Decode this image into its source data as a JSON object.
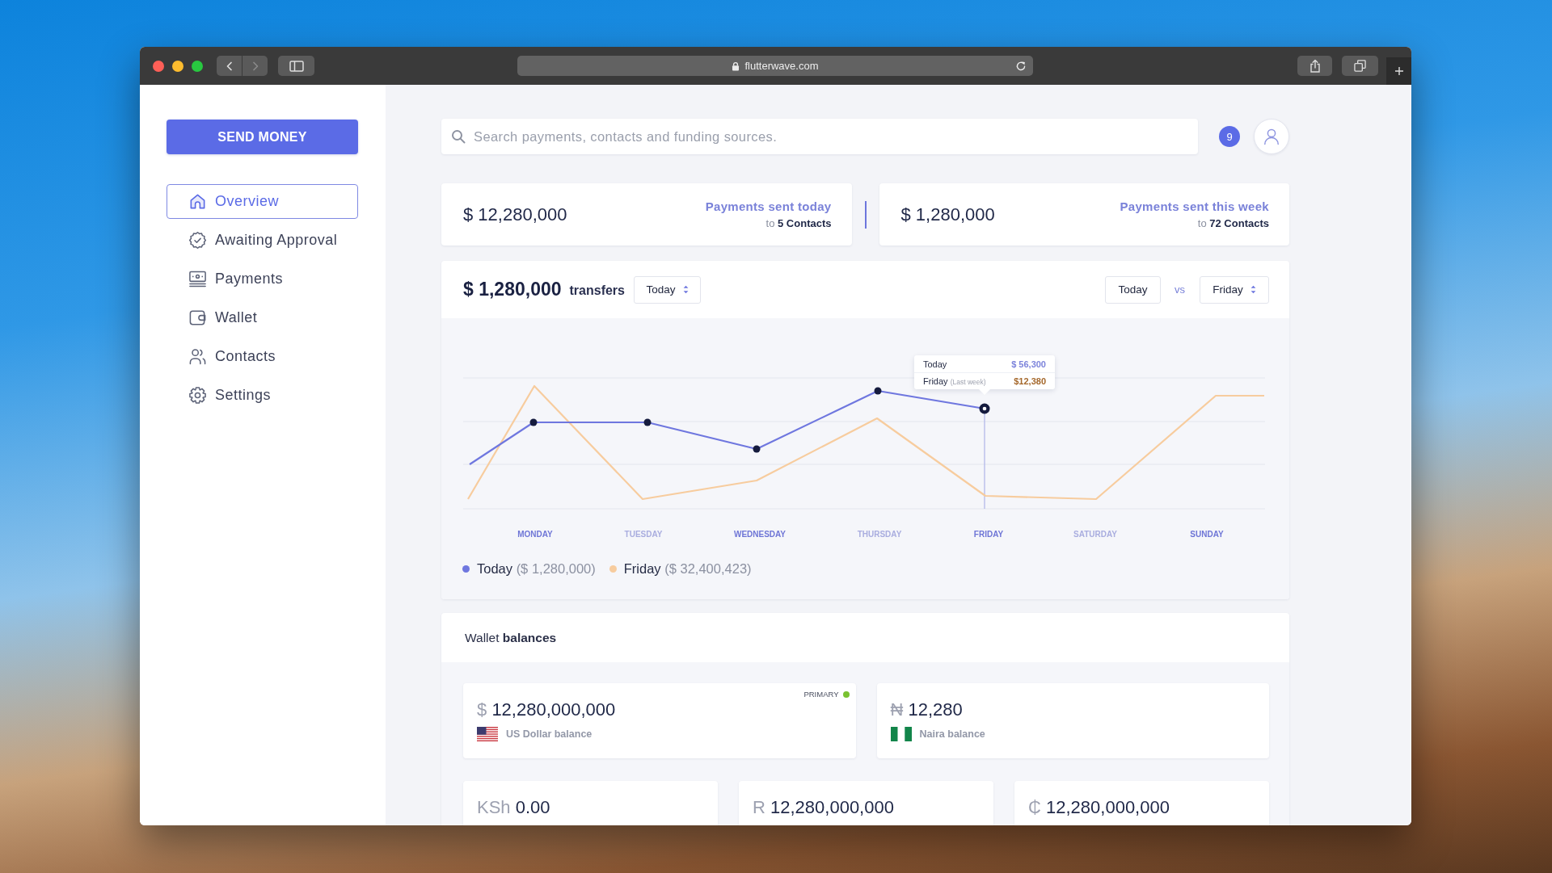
{
  "browser": {
    "url": "flutterwave.com",
    "forward_disabled": true
  },
  "sidebar": {
    "action_button": "SEND MONEY",
    "items": [
      {
        "label": "Overview",
        "selected": true
      },
      {
        "label": "Awaiting Approval",
        "selected": false
      },
      {
        "label": "Payments",
        "selected": false
      },
      {
        "label": "Wallet",
        "selected": false
      },
      {
        "label": "Contacts",
        "selected": false
      },
      {
        "label": "Settings",
        "selected": false
      }
    ]
  },
  "search": {
    "placeholder": "Search payments, contacts and funding sources."
  },
  "notifications": {
    "count": "9"
  },
  "stats": [
    {
      "amount": "$ 12,280,000",
      "title": "Payments sent today",
      "recipients": "to **5 Contacts**"
    },
    {
      "amount": "$ 1,280,000",
      "title": "Payments sent this week",
      "recipients": "to **72 Contacts**"
    }
  ],
  "transfers": {
    "amount": "$ 1,280,000",
    "label": "transfers",
    "period": "Today",
    "compare": {
      "current": "Today",
      "separator": "vs",
      "other": "Friday"
    },
    "chart": {
      "days": [
        "MONDAY",
        "TUESDAY",
        "WEDNESDAY",
        "THURSDAY",
        "FRIDAY",
        "SATURDAY",
        "SUNDAY"
      ],
      "tooltip": [
        {
          "label": "Today",
          "amount": "$ 56,300",
          "color": "#7d84db"
        },
        {
          "label": "Friday",
          "note": "(Last week)",
          "amount": "$12,380",
          "color": "#a5682c"
        }
      ],
      "legend": [
        {
          "label": "Today",
          "amount": "($ 1,280,000)",
          "color": "#6f77df"
        },
        {
          "label": "Friday",
          "amount": "($ 32,400,423)",
          "color": "#f7cc9e"
        }
      ]
    }
  },
  "wallet": {
    "title": "Wallet **balances**",
    "primary_label": "PRIMARY",
    "rows": [
      {
        "cards": [
          {
            "symbol": "$",
            "amount": "12,280,000,000",
            "label": "US Dollar balance",
            "primary": true
          },
          {
            "symbol": "₦",
            "amount": "12,280",
            "label": "Naira balance",
            "primary": false
          }
        ]
      },
      {
        "cards": [
          {
            "symbol": "KSh",
            "amount": "0.00",
            "primary": false
          },
          {
            "symbol": "R",
            "amount": "12,280,000,000",
            "primary": false
          },
          {
            "symbol": "₵",
            "amount": "12,280,000,000",
            "primary": false
          }
        ]
      }
    ]
  }
}
